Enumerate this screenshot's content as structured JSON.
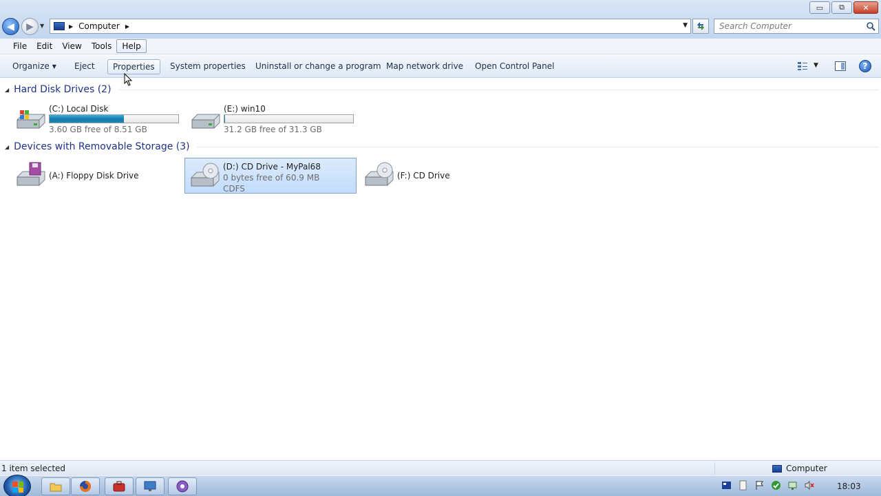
{
  "window": {
    "controls": {
      "minimize": "▭",
      "maximize": "⧉",
      "close": "✕"
    }
  },
  "nav": {
    "back_glyph": "◀",
    "forward_glyph": "▶",
    "recent_glyph": "▼"
  },
  "address": {
    "crumb": "Computer",
    "separator": "▶"
  },
  "search": {
    "placeholder": "Search Computer",
    "value": ""
  },
  "menu": {
    "items": [
      "File",
      "Edit",
      "View",
      "Tools",
      "Help"
    ],
    "active": "Help"
  },
  "toolbar": {
    "organize": "Organize",
    "eject": "Eject",
    "properties": "Properties",
    "system_properties": "System properties",
    "uninstall": "Uninstall or change a program",
    "map_network": "Map network drive",
    "control_panel": "Open Control Panel",
    "help_glyph": "?"
  },
  "groups": [
    {
      "title": "Hard Disk Drives (2)",
      "drives": [
        {
          "name": "(C:) Local Disk",
          "free": "3.60 GB free of 8.51 GB",
          "used_fraction": 0.577,
          "icon": "windows-drive-icon"
        },
        {
          "name": "(E:) win10",
          "free": "31.2 GB free of 31.3 GB",
          "used_fraction": 0.003,
          "icon": "hard-drive-icon"
        }
      ]
    },
    {
      "title": "Devices with Removable Storage (3)",
      "drives": [
        {
          "name": "(A:) Floppy Disk Drive",
          "icon": "floppy-drive-icon"
        },
        {
          "name": "(D:) CD Drive - MyPal68",
          "info1": "0 bytes free of 60.9 MB",
          "info2": "CDFS",
          "icon": "cd-drive-icon",
          "selected": true
        },
        {
          "name": "(F:) CD Drive",
          "icon": "cd-drive-icon"
        }
      ]
    }
  ],
  "status": {
    "left": "1 item selected",
    "right": "Computer"
  },
  "taskbar": {
    "clock": "18:03"
  },
  "colors": {
    "selection": "#c2dcfd",
    "group_title": "#1e3287",
    "bar_fill": "#1c78a8"
  }
}
